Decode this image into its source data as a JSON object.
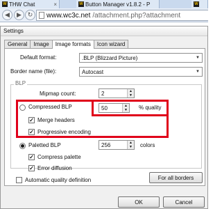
{
  "browser": {
    "tabs": [
      {
        "icon": "W",
        "title": "THW Chat"
      },
      {
        "icon": "W",
        "title": "Button Manager v1.8.2 - P"
      },
      {
        "icon": "W",
        "title": ""
      }
    ],
    "url_host": "www.wc3c.net",
    "url_path": "/attachment.php?attachment"
  },
  "dialog": {
    "title": "Settings",
    "tabs": [
      "General",
      "Image",
      "Image formats",
      "Icon wizard"
    ],
    "default_format": {
      "label": "Default format:",
      "value": ".BLP (Blizzard Picture)"
    },
    "border_name": {
      "label": "Border name (file):",
      "value": "Autocast"
    },
    "blp": {
      "group_title": "BLP",
      "mipmap_label": "Mipmap count:",
      "mipmap_value": "2",
      "compressed_label": "Compressed BLP",
      "quality_value": "50",
      "quality_label": "% quality",
      "merge_headers": "Merge headers",
      "progressive_encoding": "Progressive encoding",
      "paletted_label": "Paletted BLP",
      "colors_value": "256",
      "colors_label": "colors",
      "compress_palette": "Compress palette",
      "error_diffusion": "Error diffusion",
      "check_mark": "✓"
    },
    "auto_quality": "Automatic quality definition",
    "for_all_borders": "For all borders",
    "ok": "OK",
    "cancel": "Cancel"
  }
}
